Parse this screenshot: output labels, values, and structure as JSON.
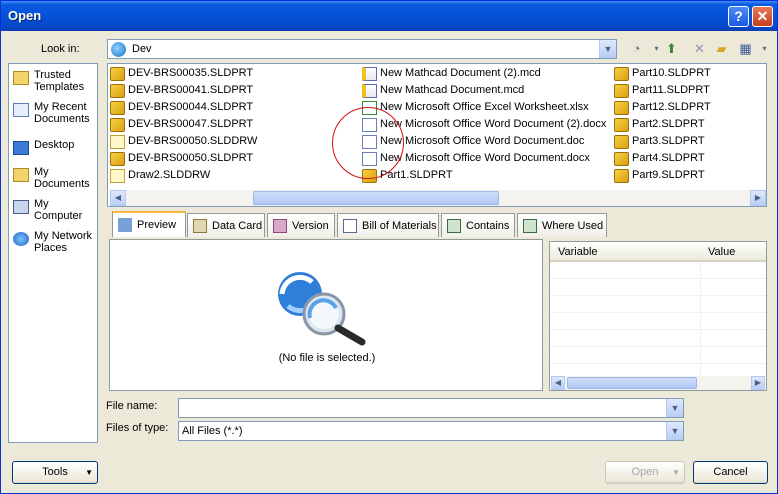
{
  "window": {
    "title": "Open"
  },
  "lookin": {
    "label": "Look in:",
    "value": "Dev"
  },
  "places": [
    {
      "label": "Trusted Templates",
      "icon": "folder-icon"
    },
    {
      "label": "My Recent Documents",
      "icon": "recent-docs-icon"
    },
    {
      "label": "Desktop",
      "icon": "desktop-icon"
    },
    {
      "label": "My Documents",
      "icon": "my-documents-icon"
    },
    {
      "label": "My Computer",
      "icon": "computer-icon"
    },
    {
      "label": "My Network Places",
      "icon": "network-icon"
    }
  ],
  "files": {
    "col1": [
      {
        "name": "DEV-BRS00035.SLDPRT",
        "type": "part"
      },
      {
        "name": "DEV-BRS00041.SLDPRT",
        "type": "part"
      },
      {
        "name": "DEV-BRS00044.SLDPRT",
        "type": "part"
      },
      {
        "name": "DEV-BRS00047.SLDPRT",
        "type": "part"
      },
      {
        "name": "DEV-BRS00050.SLDDRW",
        "type": "draw"
      },
      {
        "name": "DEV-BRS00050.SLDPRT",
        "type": "part"
      },
      {
        "name": "Draw2.SLDDRW",
        "type": "draw"
      }
    ],
    "col2": [
      {
        "name": "New Mathcad Document (2).mcd",
        "type": "mcd"
      },
      {
        "name": "New Mathcad Document.mcd",
        "type": "mcd"
      },
      {
        "name": "New Microsoft Office Excel Worksheet.xlsx",
        "type": "xls"
      },
      {
        "name": "New Microsoft Office Word Document (2).docx",
        "type": "doc"
      },
      {
        "name": "New Microsoft Office Word Document.doc",
        "type": "doc"
      },
      {
        "name": "New Microsoft Office Word Document.docx",
        "type": "doc"
      },
      {
        "name": "Part1.SLDPRT",
        "type": "part"
      }
    ],
    "col3": [
      {
        "name": "Part10.SLDPRT",
        "type": "part"
      },
      {
        "name": "Part11.SLDPRT",
        "type": "part"
      },
      {
        "name": "Part12.SLDPRT",
        "type": "part"
      },
      {
        "name": "Part2.SLDPRT",
        "type": "part"
      },
      {
        "name": "Part3.SLDPRT",
        "type": "part"
      },
      {
        "name": "Part4.SLDPRT",
        "type": "part"
      },
      {
        "name": "Part9.SLDPRT",
        "type": "part"
      }
    ]
  },
  "tabs": [
    {
      "label": "Preview",
      "icon": "preview-icon"
    },
    {
      "label": "Data Card",
      "icon": "data-card-icon"
    },
    {
      "label": "Version",
      "icon": "version-icon"
    },
    {
      "label": "Bill of Materials",
      "icon": "bom-icon"
    },
    {
      "label": "Contains",
      "icon": "contains-icon"
    },
    {
      "label": "Where Used",
      "icon": "where-used-icon"
    }
  ],
  "preview": {
    "empty_text": "(No file is selected.)"
  },
  "variables": {
    "col_variable": "Variable",
    "col_value": "Value"
  },
  "filename": {
    "label": "File name:",
    "value": ""
  },
  "filetype": {
    "label": "Files of type:",
    "value": "All Files (*.*)"
  },
  "buttons": {
    "tools": "Tools",
    "open": "Open",
    "cancel": "Cancel"
  }
}
